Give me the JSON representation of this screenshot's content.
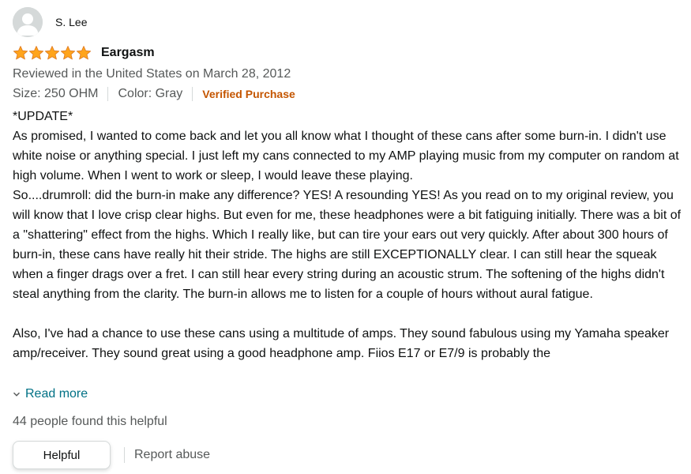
{
  "reviewer": {
    "name": "S. Lee",
    "avatar_icon": "person-silhouette-icon"
  },
  "review": {
    "rating": 5,
    "rating_max": 5,
    "star_color": "#ffa41c",
    "title": "Eargasm",
    "date_line": "Reviewed in the United States on March 28, 2012",
    "size": "Size: 250 OHM",
    "color": "Color: Gray",
    "verified": "Verified Purchase",
    "body": [
      "*UPDATE*",
      "As promised, I wanted to come back and let you all know what I thought of these cans after some burn-in. I didn't use white noise or anything special. I just left my cans connected to my AMP playing music from my computer on random at high volume. When I went to work or sleep, I would leave these playing.",
      "So....drumroll: did the burn-in make any difference? YES! A resounding YES! As you read on to my original review, you will know that I love crisp clear highs. But even for me, these headphones were a bit fatiguing initially. There was a bit of a \"shattering\" effect from the highs. Which I really like, but can tire your ears out very quickly. After about 300 hours of burn-in, these cans have really hit their stride. The highs are still EXCEPTIONALLY clear. I can still hear the squeak when a finger drags over a fret. I can still hear every string during an acoustic strum. The softening of the highs didn't steal anything from the clarity. The burn-in allows me to listen for a couple of hours without aural fatigue.",
      "",
      "Also, I've had a chance to use these cans using a multitude of amps. They sound fabulous using my Yamaha speaker amp/receiver. They sound great using a good headphone amp. Fiios E17 or E7/9 is probably the"
    ],
    "read_more": "Read more",
    "helpful_count": "44 people found this helpful",
    "helpful_button": "Helpful",
    "report_abuse": "Report abuse"
  },
  "colors": {
    "link": "#007185",
    "verified": "#c45500",
    "secondary_text": "#565959"
  }
}
